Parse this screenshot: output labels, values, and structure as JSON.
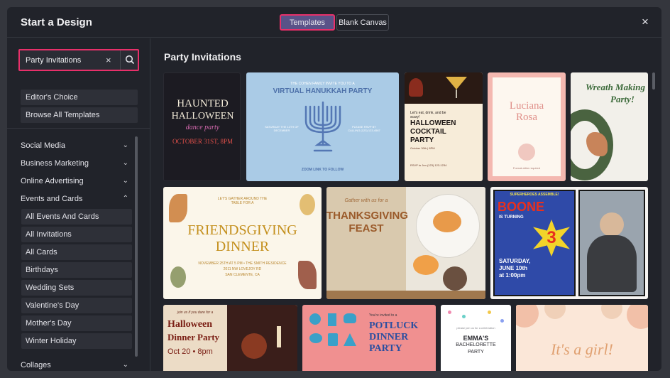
{
  "modal": {
    "title": "Start a Design",
    "toggle": {
      "templates": "Templates",
      "blank": "Blank Canvas"
    },
    "close_icon": "×"
  },
  "search": {
    "value": "Party Invitations",
    "clear_icon": "×"
  },
  "sidebar": {
    "pills": [
      "Editor's Choice",
      "Browse All Templates"
    ],
    "categories": [
      {
        "label": "Social Media",
        "chev": "⌄"
      },
      {
        "label": "Business Marketing",
        "chev": "⌄"
      },
      {
        "label": "Online Advertising",
        "chev": "⌄"
      },
      {
        "label": "Events and Cards",
        "chev": "⌃"
      }
    ],
    "subitems": [
      "All Events And Cards",
      "All Invitations",
      "All Cards",
      "Birthdays",
      "Wedding Sets",
      "Valentine's Day",
      "Mother's Day",
      "Winter Holiday"
    ],
    "collages": {
      "label": "Collages",
      "chev": "⌄"
    }
  },
  "main": {
    "section_title": "Party Invitations",
    "cards": {
      "halloween": {
        "l1": "HAUNTED",
        "l2": "HALLOWEEN",
        "l3": "dance party",
        "l4": "OCTOBER 31ST, 8PM"
      },
      "hanukkah": {
        "pre": "THE COHEN FAMILY INVITE YOU TO A",
        "title": "VIRTUAL HANUKKAH PARTY",
        "left": "SATURDAY THE 12TH OF DECEMBER",
        "right": "PLEASE RSVP BY CALLING (123) 123-4567",
        "link": "ZOOM LINK TO FOLLOW"
      },
      "cocktail": {
        "pre": "Let's eat, drink, and be scary!",
        "title": "HALLOWEEN COCKTAIL PARTY",
        "date": "October 30th | 8PM",
        "rsvp": "RSVP to Jen (123) 123-1234"
      },
      "luciana": {
        "name1": "Luciana",
        "name2": "Rosa",
        "foot": "Formal attire required"
      },
      "wreath": {
        "t1": "Wreath Making",
        "t2": "Party!"
      },
      "friendsgiving": {
        "pre": "LET'S GATHER AROUND THE TABLE FOR A",
        "t1": "FRIENDSGIVING",
        "t2": "DINNER",
        "date": "NOVEMBER 25TH AT 5 PM • THE SMITH RESIDENCE",
        "addr1": "2011 NW LOVEJOY RD",
        "addr2": "SAN CLEMENTE, CA"
      },
      "thanksgiving": {
        "pre": "Gather with us for a",
        "t1": "THANKSGIVING",
        "t2": "FEAST"
      },
      "boone": {
        "pre": "SUPERHEROES ASSEMBLE!",
        "name": "BOONE",
        "turning": "IS TURNING",
        "age": "3",
        "date1": "SATURDAY,",
        "date2": "JUNE 10th",
        "date3": "at 1:00pm"
      },
      "halloween_dinner": {
        "pre": "join us if you dare for a",
        "t1": "Halloween",
        "t2": "Dinner Party",
        "date": "Oct 20 • 8pm"
      },
      "potluck": {
        "pre": "You're invited to a",
        "t1": "POTLUCK",
        "t2": "DINNER",
        "t3": "PARTY"
      },
      "bachelorette": {
        "pre": "please join us for a celebration",
        "t1": "EMMA'S",
        "t2": "BACHELORETTE",
        "t3": "PARTY"
      },
      "girl": {
        "t1": "It's a girl!"
      }
    }
  }
}
